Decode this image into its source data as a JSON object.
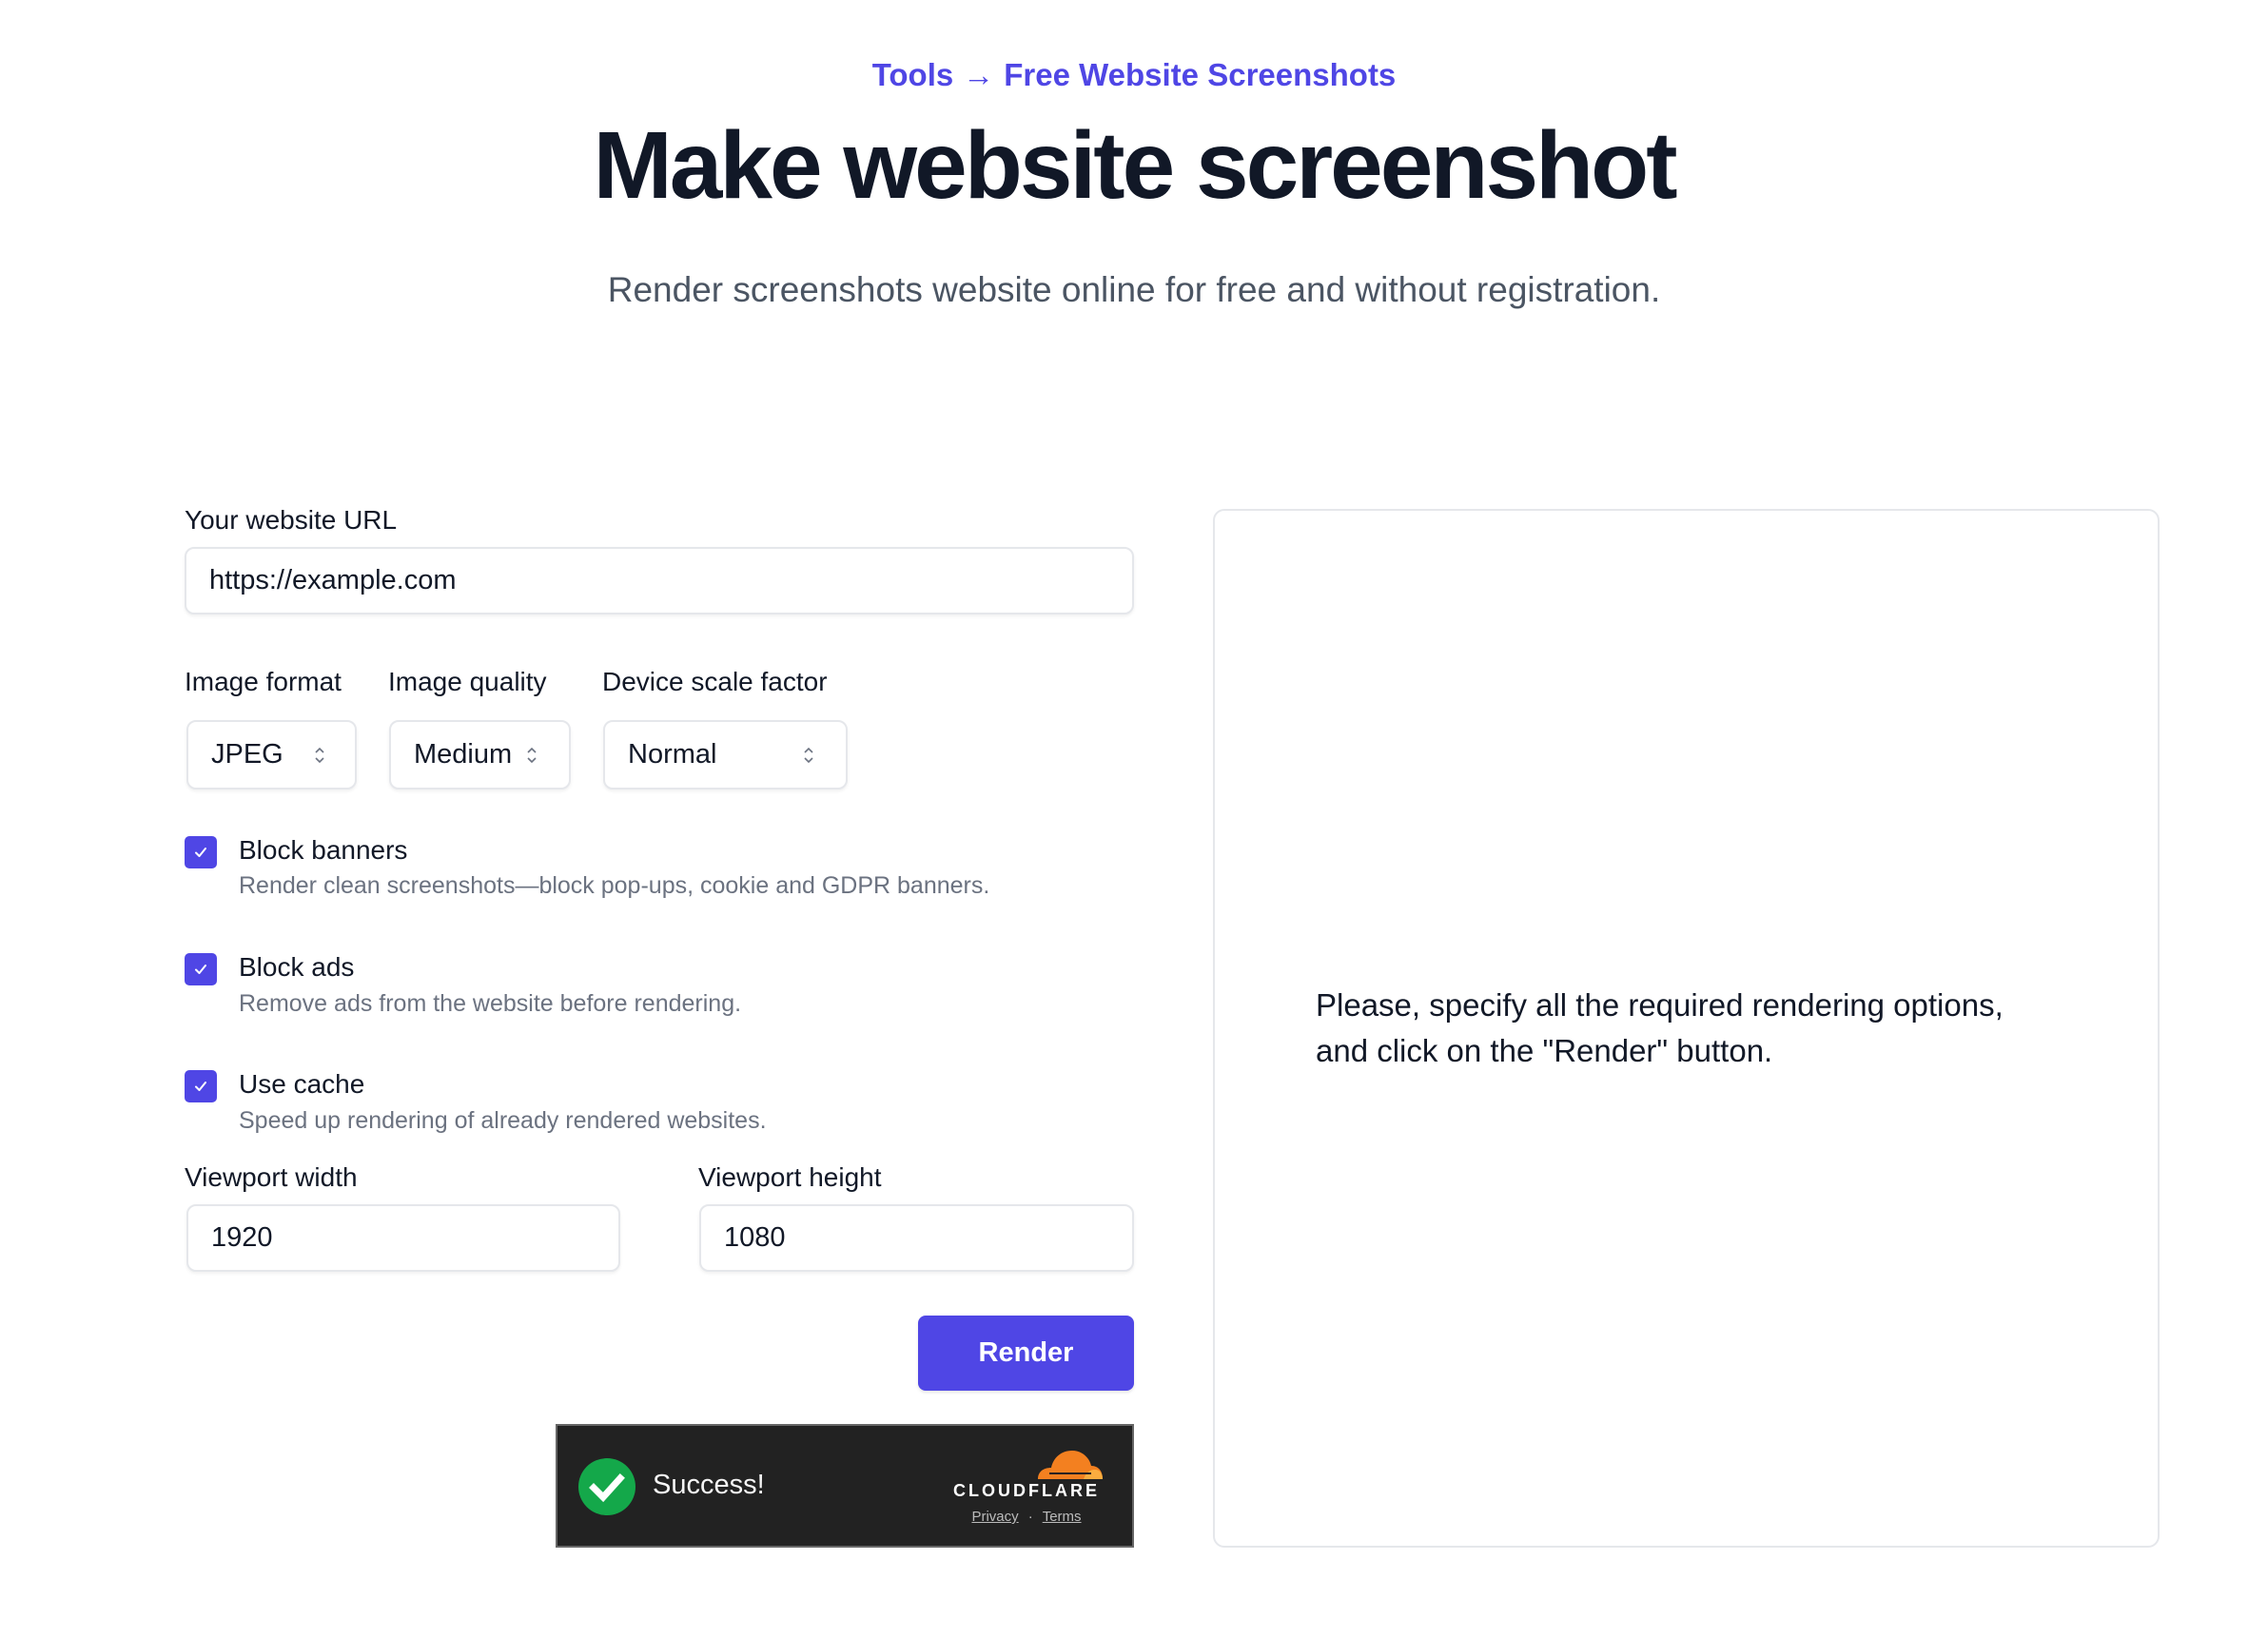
{
  "header": {
    "breadcrumb": [
      {
        "label": "Tools"
      },
      {
        "label": "Free Website Screenshots"
      }
    ],
    "breadcrumb_separator": "→",
    "title": "Make website screenshot",
    "subtitle": "Render screenshots website online for free and without registration."
  },
  "form": {
    "url": {
      "label": "Your website URL",
      "value": "https://example.com"
    },
    "image_format": {
      "label": "Image format",
      "value": "JPEG"
    },
    "image_quality": {
      "label": "Image quality",
      "value": "Medium"
    },
    "device_scale_factor": {
      "label": "Device scale factor",
      "value": "Normal"
    },
    "options": [
      {
        "title": "Block banners",
        "description": "Render clean screenshots—block pop-ups, cookie and GDPR banners.",
        "checked": true
      },
      {
        "title": "Block ads",
        "description": "Remove ads from the website before rendering.",
        "checked": true
      },
      {
        "title": "Use cache",
        "description": "Speed up rendering of already rendered websites.",
        "checked": true
      }
    ],
    "viewport_width": {
      "label": "Viewport width",
      "value": "1920"
    },
    "viewport_height": {
      "label": "Viewport height",
      "value": "1080"
    },
    "render_label": "Render"
  },
  "captcha": {
    "status": "Success!",
    "brand": "CLOUDFLARE",
    "privacy_label": "Privacy",
    "separator": "·",
    "terms_label": "Terms"
  },
  "preview": {
    "message_line1": "Please, specify all the required rendering options,",
    "message_line2": "and click on the \"Render\" button."
  },
  "colors": {
    "accent": "#4f46e5",
    "success": "#14a84a",
    "cloudflare_orange": "#f38020"
  }
}
